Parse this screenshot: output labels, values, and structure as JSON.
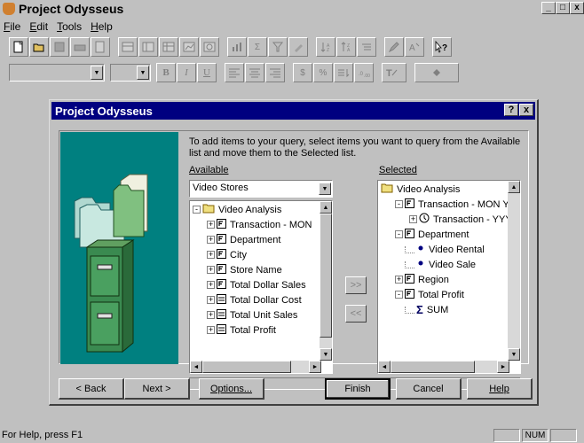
{
  "app": {
    "title": "Project Odysseus"
  },
  "window_controls": {
    "minimize": "_",
    "restore": "□",
    "close": "x"
  },
  "menu": [
    {
      "label": "File",
      "ul": "F",
      "rest": "ile"
    },
    {
      "label": "Edit",
      "ul": "E",
      "rest": "dit"
    },
    {
      "label": "Tools",
      "ul": "T",
      "rest": "ools"
    },
    {
      "label": "Help",
      "ul": "H",
      "rest": "elp"
    }
  ],
  "format_toolbar": {
    "bold": "B",
    "italic": "I",
    "underline": "U",
    "currency": "$",
    "percent": "%"
  },
  "dialog": {
    "title": "Project Odysseus",
    "help_btn": "?",
    "close_btn": "x",
    "instructions": "To add items to your query, select items you want to query from the Available list and move them to the Selected list.",
    "available_label": "Available",
    "selected_label": "Selected",
    "available_combo": "Video Stores",
    "available_tree": [
      {
        "label": "Video Analysis",
        "level": 0,
        "exp": "-",
        "icon": "folder"
      },
      {
        "label": "Transaction - MON",
        "level": 1,
        "exp": "+",
        "icon": "dim"
      },
      {
        "label": "Department",
        "level": 1,
        "exp": "+",
        "icon": "dim"
      },
      {
        "label": "City",
        "level": 1,
        "exp": "+",
        "icon": "dim"
      },
      {
        "label": "Store Name",
        "level": 1,
        "exp": "+",
        "icon": "dim"
      },
      {
        "label": "Total Dollar Sales",
        "level": 1,
        "exp": "+",
        "icon": "dim"
      },
      {
        "label": "Total Dollar Cost",
        "level": 1,
        "exp": "+",
        "icon": "measure"
      },
      {
        "label": "Total Unit Sales",
        "level": 1,
        "exp": "+",
        "icon": "measure"
      },
      {
        "label": "Total Profit",
        "level": 1,
        "exp": "+",
        "icon": "measure"
      }
    ],
    "selected_tree": [
      {
        "label": "Video Analysis",
        "level": 0,
        "exp": "",
        "icon": "folder"
      },
      {
        "label": "Transaction - MON YY",
        "level": 1,
        "exp": "-",
        "icon": "dim"
      },
      {
        "label": "Transaction - YYY",
        "level": 2,
        "exp": "+",
        "icon": "clock"
      },
      {
        "label": "Department",
        "level": 1,
        "exp": "-",
        "icon": "dim"
      },
      {
        "label": "Video Rental",
        "level": 2,
        "exp": "",
        "icon": "dot"
      },
      {
        "label": "Video Sale",
        "level": 2,
        "exp": "",
        "icon": "dot"
      },
      {
        "label": "Region",
        "level": 1,
        "exp": "+",
        "icon": "dim"
      },
      {
        "label": "Total Profit",
        "level": 1,
        "exp": "-",
        "icon": "dim"
      },
      {
        "label": "SUM",
        "level": 2,
        "exp": "",
        "icon": "sigma"
      }
    ],
    "add_btn": ">>",
    "remove_btn": "<<",
    "buttons": {
      "back": "< Back",
      "next": "Next >",
      "options": "Options...",
      "finish": "Finish",
      "cancel": "Cancel",
      "help": "Help"
    }
  },
  "status": {
    "text": "For Help, press F1",
    "num": "NUM"
  }
}
